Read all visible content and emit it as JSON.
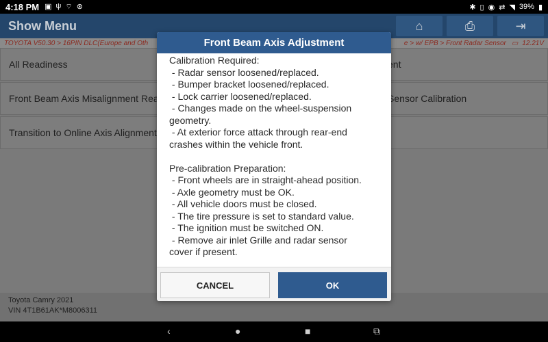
{
  "status_bar": {
    "time": "4:18 PM",
    "battery": "39%",
    "left_icons": [
      "image-icon",
      "usb-icon",
      "wifi-off-icon",
      "steering-icon"
    ],
    "right_icons": [
      "bluetooth-icon",
      "vibrate-icon",
      "location-icon",
      "signal-icon",
      "wifi-icon"
    ]
  },
  "header": {
    "title": "Show Menu",
    "buttons": [
      "home-icon",
      "print-icon",
      "exit-icon"
    ]
  },
  "breadcrumb": {
    "text": "TOYOTA V50.30 > 16PIN DLC(Europe and Oth",
    "text_right": "e > w/ EPB > Front Radar Sensor",
    "voltage": "12.21V"
  },
  "menu_items": [
    "All Readiness",
    "ent",
    "Front Beam Axis Misalignment Rea",
    "Sensor Calibration",
    "Transition to Online Axis Alignment"
  ],
  "vehicle": {
    "model": "Toyota Camry 2021",
    "vin": "VIN 4T1B61AK*M8006311"
  },
  "dialog": {
    "title": "Front Beam Axis Adjustment",
    "lines": [
      "Calibration Required:",
      " - Radar sensor loosened/replaced.",
      " - Bumper bracket loosened/replaced.",
      " - Lock carrier loosened/replaced.",
      " - Changes made on the wheel-suspension",
      "geometry.",
      " - At exterior force attack through rear-end",
      "crashes within the vehicle front.",
      "",
      "Pre-calibration Preparation:",
      " - Front wheels are in straight-ahead position.",
      " - Axle geometry must be OK.",
      " - All vehicle doors must be closed.",
      " - The tire pressure is set to standard value.",
      " - The ignition must be switched ON.",
      " - Remove air inlet Grille and radar sensor",
      "cover if present."
    ],
    "cancel_label": "CANCEL",
    "ok_label": "OK"
  },
  "colors": {
    "header_bg": "#24466b",
    "dialog_title_bg": "#2f5b8f",
    "ok_button_bg": "#2f5b8f"
  }
}
